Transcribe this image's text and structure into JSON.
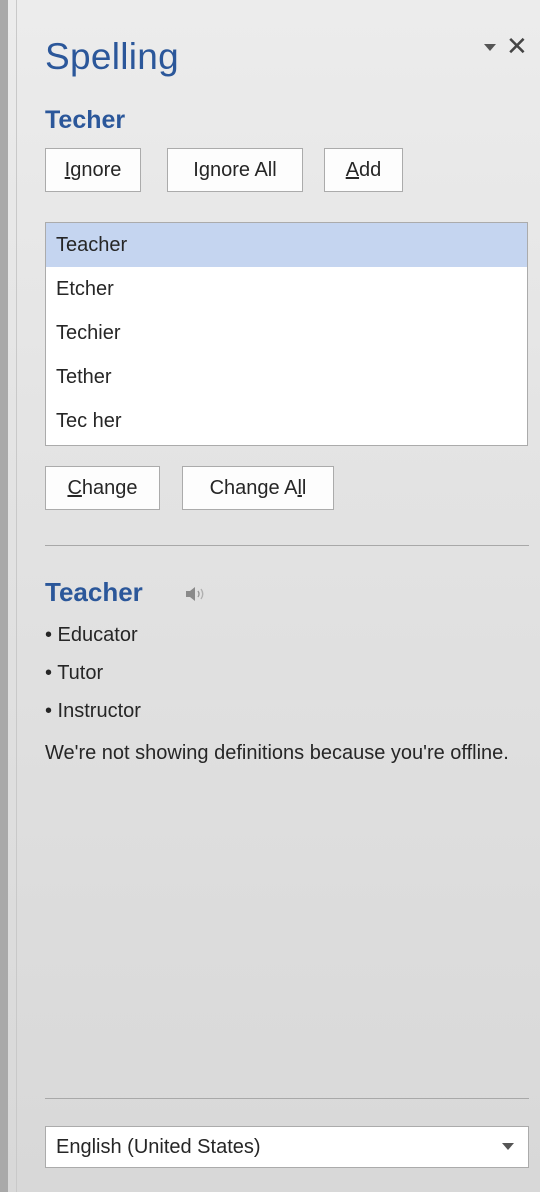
{
  "pane": {
    "title": "Spelling",
    "menu_icon": "dropdown-arrow-icon",
    "close_glyph": "✕"
  },
  "misspelled_word": "Techer",
  "buttons": {
    "ignore": {
      "prefix": "",
      "accel": "I",
      "rest": "gnore"
    },
    "ignore_all": {
      "prefix": "I",
      "accel": "g",
      "rest": "nore All"
    },
    "add": {
      "prefix": "",
      "accel": "A",
      "rest": "dd"
    },
    "change": {
      "prefix": "",
      "accel": "C",
      "rest": "hange"
    },
    "change_all": {
      "prefix": "Change A",
      "accel": "l",
      "rest": "l"
    }
  },
  "suggestions": [
    "Teacher",
    "Etcher",
    "Techier",
    "Tether",
    "Tec her"
  ],
  "selected_suggestion_index": 0,
  "definition": {
    "word": "Teacher",
    "speaker_icon": "speaker-icon",
    "synonyms": [
      "• Educator",
      "• Tutor",
      "• Instructor"
    ],
    "offline_message": "We're not showing definitions because you're offline."
  },
  "language": {
    "selected": "English (United States)"
  },
  "colors": {
    "accent": "#2b579a",
    "selection": "#c5d5f0"
  }
}
